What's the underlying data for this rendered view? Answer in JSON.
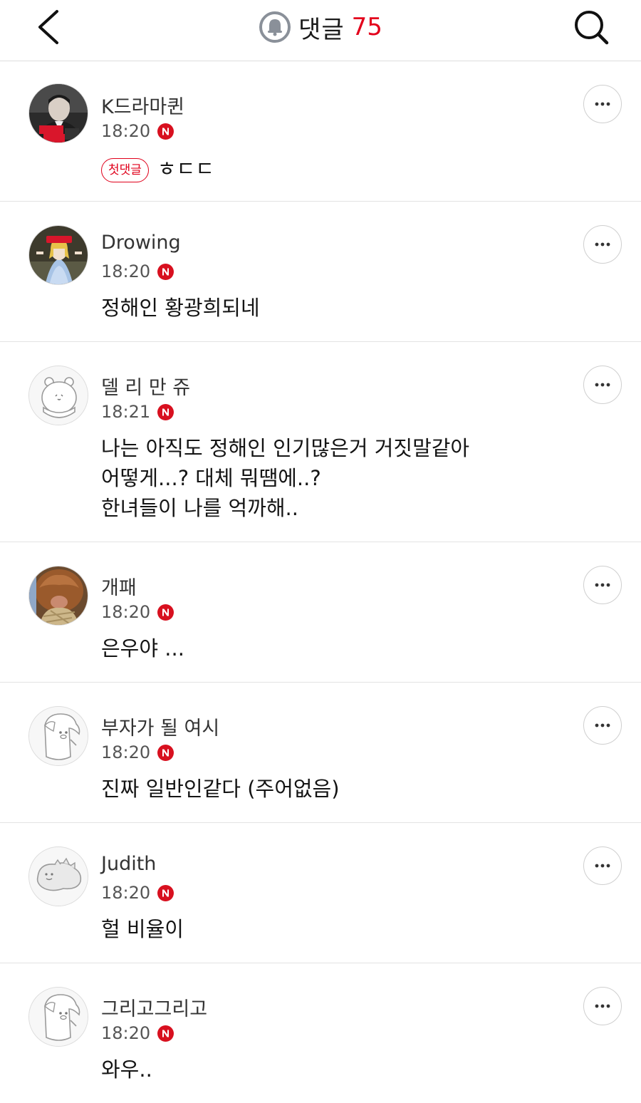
{
  "header": {
    "title": "댓글",
    "count": "75",
    "back_icon": "chevron-left-icon",
    "bell_icon": "bell-icon",
    "search_icon": "search-icon",
    "accent_color": "#e3001b"
  },
  "comments": [
    {
      "username": "K드라마퀸",
      "time": "18:20",
      "badge": "첫댓글",
      "text": "ㅎㄷㄷ",
      "avatar": "profile-photo-avatar"
    },
    {
      "username": "Drowing",
      "time": "18:20",
      "text": "정해인 황광희되네",
      "avatar": "illustrated-girl-avatar"
    },
    {
      "username": "델 리 만 쥬",
      "time": "18:21",
      "text_lines": [
        "나는 아직도 정해인 인기많은거 거짓말같아",
        "어떻게...? 대체 뭐땜에..?",
        "한녀들이 나를 억까해.."
      ],
      "avatar": "default-hamster-avatar"
    },
    {
      "username": "개패",
      "time": "18:20",
      "text": "은우야 ...",
      "avatar": "highland-cow-avatar"
    },
    {
      "username": "부자가 될 여시",
      "time": "18:20",
      "text": "진짜 일반인같다 (주어없음)",
      "avatar": "default-fox-avatar"
    },
    {
      "username": "Judith",
      "time": "18:20",
      "text": "헐 비율이",
      "avatar": "default-lizard-avatar"
    },
    {
      "username": "그리고그리고",
      "time": "18:20",
      "text": "와우..",
      "avatar": "default-fox-avatar"
    }
  ]
}
